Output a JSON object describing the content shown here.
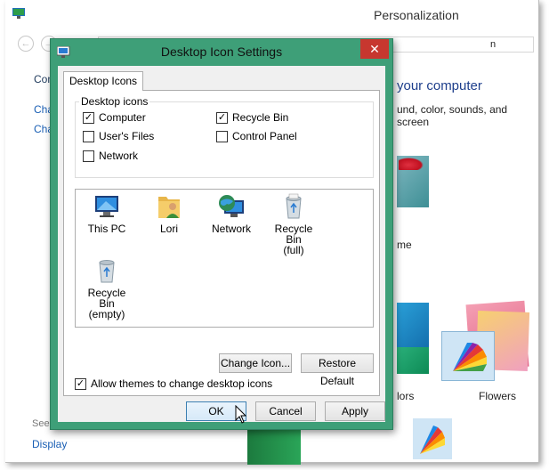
{
  "background_window": {
    "title": "Personalization",
    "address_fragment": "n",
    "left_link_1": "Con",
    "left_link_2": "Cha",
    "left_link_3": "Cha",
    "heading": "your computer",
    "subtext": "und, color, sounds, and screen",
    "theme_label_me": "me",
    "theme_label_colors": "lors",
    "theme_label_flowers": "Flowers",
    "see_also": "See",
    "display_link": "Display"
  },
  "dialog": {
    "title": "Desktop Icon Settings",
    "close_glyph": "✕",
    "tab_label": "Desktop Icons",
    "group_label": "Desktop icons",
    "checkboxes": [
      {
        "label": "Computer",
        "checked": true
      },
      {
        "label": "Recycle Bin",
        "checked": true
      },
      {
        "label": "User's Files",
        "checked": false
      },
      {
        "label": "Control Panel",
        "checked": false
      },
      {
        "label": "Network",
        "checked": false
      }
    ],
    "icons": [
      {
        "label": "This PC",
        "icon": "computer-monitor-icon"
      },
      {
        "label": "Lori",
        "icon": "user-folder-icon"
      },
      {
        "label": "Network",
        "icon": "network-globe-icon"
      },
      {
        "label": "Recycle Bin (full)",
        "line1": "Recycle Bin",
        "line2": "(full)",
        "icon": "recycle-bin-full-icon"
      },
      {
        "label": "Recycle Bin (empty)",
        "line1": "Recycle Bin",
        "line2": "(empty)",
        "icon": "recycle-bin-empty-icon"
      }
    ],
    "change_icon_label": "Change Icon...",
    "restore_default_label": "Restore Default",
    "allow_themes_label": "Allow themes to change desktop icons",
    "allow_themes_checked": true,
    "ok_label": "OK",
    "cancel_label": "Cancel",
    "apply_label": "Apply",
    "check_glyph": "✓"
  },
  "colors": {
    "dialog_frame": "#3e9f78",
    "close_button": "#c7372f",
    "link_blue": "#1a5fb4"
  }
}
